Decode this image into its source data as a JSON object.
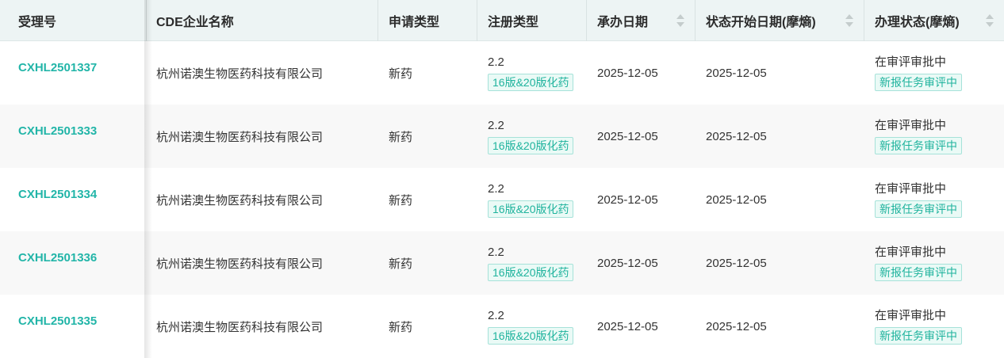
{
  "columns": [
    {
      "label": "受理号",
      "sortable": false
    },
    {
      "label": "CDE企业名称",
      "sortable": false
    },
    {
      "label": "申请类型",
      "sortable": false
    },
    {
      "label": "注册类型",
      "sortable": false
    },
    {
      "label": "承办日期",
      "sortable": true
    },
    {
      "label": "状态开始日期(摩熵)",
      "sortable": true
    },
    {
      "label": "办理状态(摩熵)",
      "sortable": true
    }
  ],
  "rows": [
    {
      "accept_no": "CXHL2501337",
      "company": "杭州诺澳生物医药科技有限公司",
      "apply_type": "新药",
      "reg_type": "2.2",
      "reg_tag": "16版&20版化药",
      "undertake_date": "2025-12-05",
      "status_start_date": "2025-12-05",
      "status": "在审评审批中",
      "status_tag": "新报任务审评中"
    },
    {
      "accept_no": "CXHL2501333",
      "company": "杭州诺澳生物医药科技有限公司",
      "apply_type": "新药",
      "reg_type": "2.2",
      "reg_tag": "16版&20版化药",
      "undertake_date": "2025-12-05",
      "status_start_date": "2025-12-05",
      "status": "在审评审批中",
      "status_tag": "新报任务审评中"
    },
    {
      "accept_no": "CXHL2501334",
      "company": "杭州诺澳生物医药科技有限公司",
      "apply_type": "新药",
      "reg_type": "2.2",
      "reg_tag": "16版&20版化药",
      "undertake_date": "2025-12-05",
      "status_start_date": "2025-12-05",
      "status": "在审评审批中",
      "status_tag": "新报任务审评中"
    },
    {
      "accept_no": "CXHL2501336",
      "company": "杭州诺澳生物医药科技有限公司",
      "apply_type": "新药",
      "reg_type": "2.2",
      "reg_tag": "16版&20版化药",
      "undertake_date": "2025-12-05",
      "status_start_date": "2025-12-05",
      "status": "在审评审批中",
      "status_tag": "新报任务审评中"
    },
    {
      "accept_no": "CXHL2501335",
      "company": "杭州诺澳生物医药科技有限公司",
      "apply_type": "新药",
      "reg_type": "2.2",
      "reg_tag": "16版&20版化药",
      "undertake_date": "2025-12-05",
      "status_start_date": "2025-12-05",
      "status": "在审评审批中",
      "status_tag": "新报任务审评中"
    }
  ],
  "colors": {
    "accent": "#22b5a8",
    "tag_text": "#1fb39d",
    "tag_border": "#a6e2d9",
    "tag_bg": "#eafaf6",
    "header_bg": "#edf4f4",
    "row_alt_bg": "#f8f8f8"
  },
  "icons": {
    "sort": "sort-arrows-icon"
  }
}
